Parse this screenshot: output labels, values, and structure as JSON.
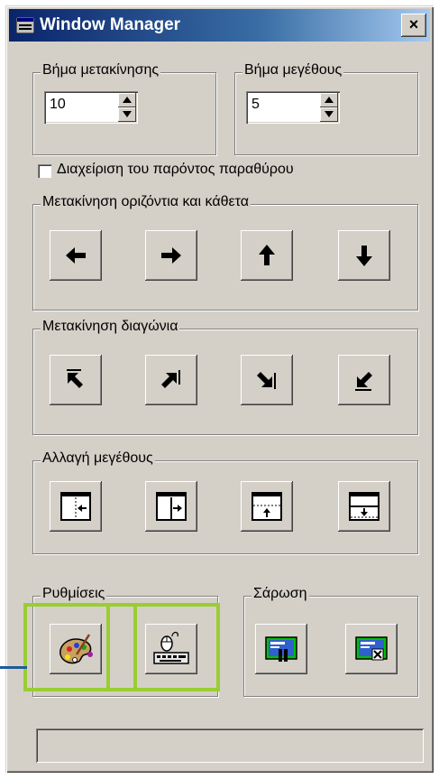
{
  "window": {
    "title": "Window Manager",
    "close_label": "×"
  },
  "move_step": {
    "legend": "Βήμα μετακίνησης",
    "value": "10"
  },
  "size_step": {
    "legend": "Βήμα μεγέθους",
    "value": "5"
  },
  "manage_current": {
    "label": "Διαχείριση του παρόντος παραθύρου",
    "checked": false
  },
  "move_hv": {
    "legend": "Μετακίνηση οριζόντια και κάθετα",
    "buttons": [
      "arrow-left-icon",
      "arrow-right-icon",
      "arrow-up-icon",
      "arrow-down-icon"
    ]
  },
  "move_diag": {
    "legend": "Μετακίνηση διαγώνια",
    "buttons": [
      "arrow-up-left-icon",
      "arrow-up-right-icon",
      "arrow-down-right-icon",
      "arrow-down-left-icon"
    ]
  },
  "resize": {
    "legend": "Αλλαγή μεγέθους",
    "buttons": [
      "shrink-width-icon",
      "grow-width-icon",
      "shrink-height-icon",
      "grow-height-icon"
    ]
  },
  "settings": {
    "legend": "Ρυθμίσεις",
    "buttons": [
      "palette-icon",
      "keyboard-mouse-icon"
    ]
  },
  "scan": {
    "legend": "Σάρωση",
    "buttons": [
      "scan-pause-icon",
      "scan-stop-icon"
    ]
  },
  "colors": {
    "face": "#d4d0c8",
    "title_start": "#0a246a",
    "title_end": "#a6caf0",
    "highlight": "#9acd32"
  }
}
